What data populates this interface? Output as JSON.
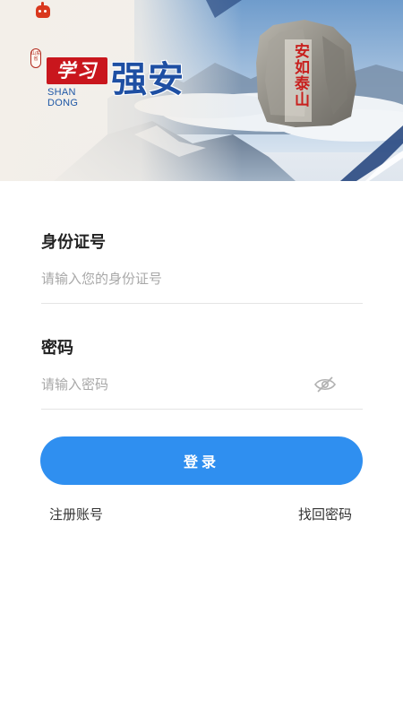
{
  "banner": {
    "seal_text": "山东省",
    "logo_text": "学习",
    "logo_subtext": "SHAN DONG",
    "big_title": "强安",
    "stone_inscription": "安如泰山",
    "colors": {
      "logo_red": "#c9161d",
      "title_blue": "#1e4fa3",
      "inscription_red": "#c8201e"
    }
  },
  "status_bar": {
    "app_icon": "red-robot-app-icon"
  },
  "form": {
    "id_label": "身份证号",
    "id_placeholder": "请输入您的身份证号",
    "id_value": "",
    "password_label": "密码",
    "password_placeholder": "请输入密码",
    "password_value": "",
    "password_toggle_icon": "eye-hidden-icon"
  },
  "actions": {
    "login_label": "登录",
    "register_label": "注册账号",
    "forgot_label": "找回密码"
  },
  "colors": {
    "primary": "#2f8ff0",
    "divider": "#e4e4e4",
    "placeholder": "#a8a8a8"
  }
}
